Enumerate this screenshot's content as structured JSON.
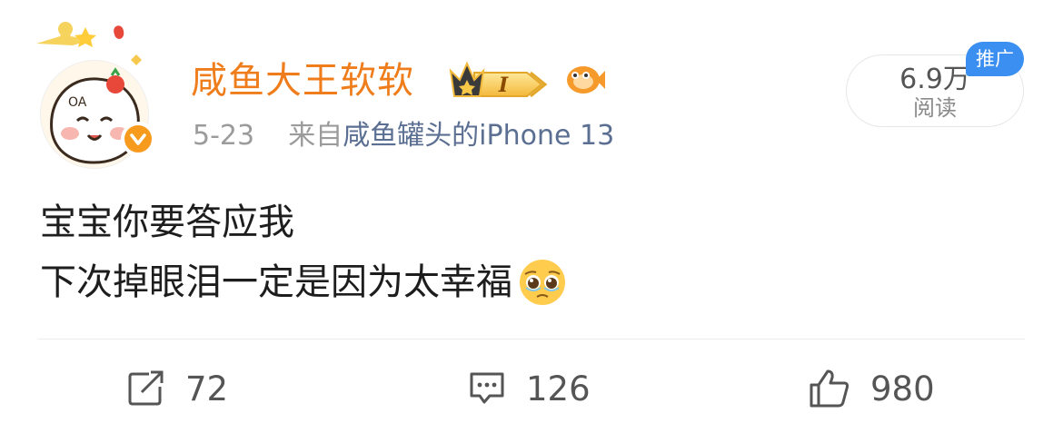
{
  "user": {
    "name": "咸鱼大王软软",
    "badge_level": "I",
    "verified": true
  },
  "post": {
    "date": "5-23",
    "source_prefix": "来自",
    "source": "咸鱼罐头的iPhone 13",
    "lines": [
      "宝宝你要答应我",
      "下次掉眼泪一定是因为太幸福"
    ],
    "emoji": "pleading-face"
  },
  "reads": {
    "count": "6.9万",
    "label": "阅读"
  },
  "promo_tag": "推广",
  "actions": {
    "repost": "72",
    "comment": "126",
    "like": "980"
  },
  "colors": {
    "username": "#ef7d1c",
    "verified": "#f79b1e",
    "source_link": "#5b6f93",
    "promo": "#3b8ff0"
  }
}
